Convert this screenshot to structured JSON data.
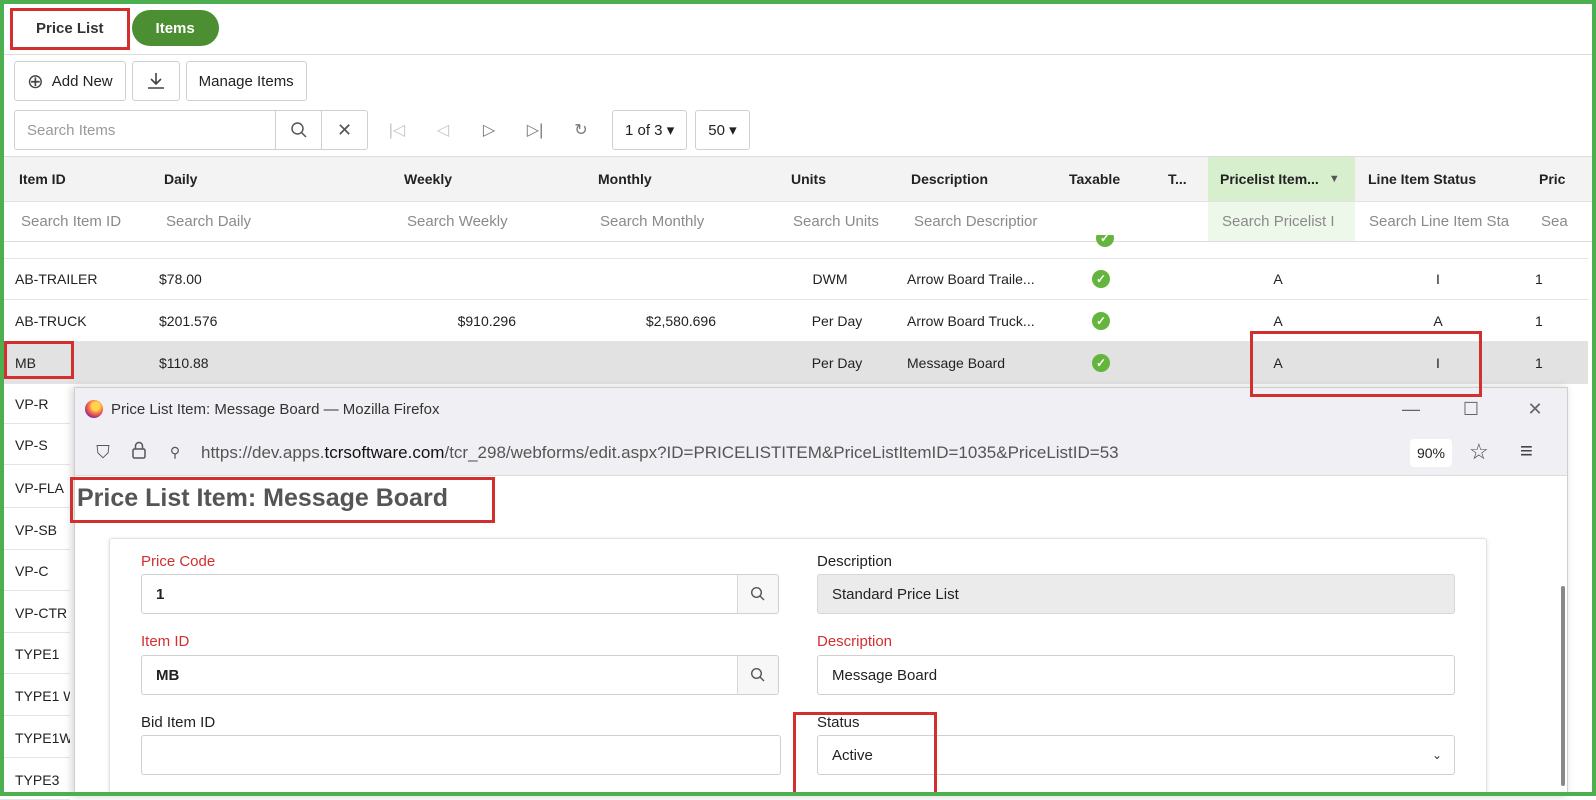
{
  "tabs": [
    {
      "label": "Price List"
    },
    {
      "label": "Items"
    }
  ],
  "toolbar": {
    "add_new_label": "Add New",
    "manage_items_label": "Manage Items"
  },
  "pager": {
    "search_placeholder": "Search Items",
    "page_label": "1 of 3 ▾",
    "page_size_label": "50 ▾"
  },
  "grid": {
    "columns": [
      "Item ID",
      "Daily",
      "Weekly",
      "Monthly",
      "Units",
      "Description",
      "Taxable",
      "T...",
      "Pricelist Item...",
      "Line Item Status",
      "Pric"
    ],
    "filters": [
      "Search Item ID",
      "Search Daily",
      "Search Weekly",
      "Search Monthly",
      "Search Units",
      "Search Descriptior",
      "Search Pricelist I",
      "Search Line Item Sta",
      "Sea"
    ],
    "rows": [
      {
        "item_id": "AB-TRAILER",
        "daily": "$78.00",
        "weekly": "",
        "monthly": "",
        "units": "DWM",
        "description": "Arrow Board Traile...",
        "taxable": true,
        "pricelist": "A",
        "status": "I",
        "pric": "1"
      },
      {
        "item_id": "AB-TRUCK",
        "daily": "$201.576",
        "weekly": "$910.296",
        "monthly": "$2,580.696",
        "units": "Per Day",
        "description": "Arrow Board Truck...",
        "taxable": true,
        "pricelist": "A",
        "status": "A",
        "pric": "1"
      },
      {
        "item_id": "MB",
        "daily": "$110.88",
        "weekly": "",
        "monthly": "",
        "units": "Per Day",
        "description": "Message Board",
        "taxable": true,
        "pricelist": "A",
        "status": "I",
        "pric": "1"
      }
    ],
    "left_rows": [
      "VP-R",
      "VP-S",
      "VP-FLA",
      "VP-SB",
      "VP-C",
      "VP-CTR",
      "TYPE1",
      "TYPE1 W",
      "TYPE1W",
      "TYPE3"
    ]
  },
  "firefox": {
    "window_title": "Price List Item: Message Board — Mozilla Firefox",
    "url_prefix": "https://dev.apps.",
    "url_host": "tcrsoftware.com",
    "url_path": "/tcr_298/webforms/edit.aspx?ID=PRICELISTITEM&PriceListItemID=1035&PriceListID=53",
    "zoom": "90%"
  },
  "form": {
    "page_title": "Price List Item: Message Board",
    "price_code_label": "Price Code",
    "price_code_value": "1",
    "description1_label": "Description",
    "description1_value": "Standard Price List",
    "item_id_label": "Item ID",
    "item_id_value": "MB",
    "description2_label": "Description",
    "description2_value": "Message Board",
    "bid_item_label": "Bid Item ID",
    "bid_item_value": "",
    "status_label": "Status",
    "status_value": "Active"
  },
  "colors": {
    "accent_green": "#4c8e32",
    "frame_green": "#4caf50",
    "highlight_red": "#d32f2f",
    "check_green": "#63b53d"
  }
}
